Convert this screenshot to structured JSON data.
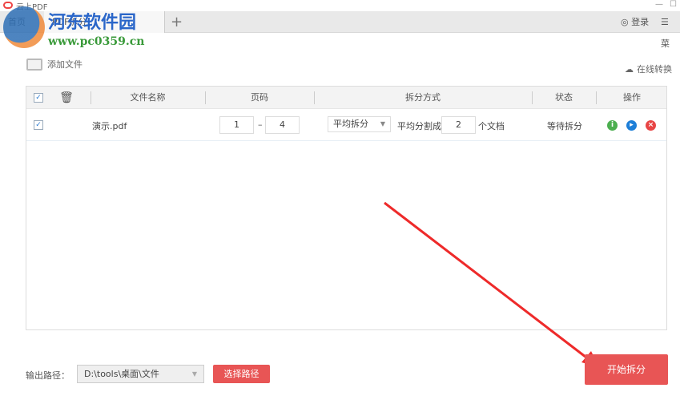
{
  "app": {
    "title": "云上PDF",
    "minimize": "—",
    "maximize": "☐"
  },
  "tabs": [
    {
      "label": "首页"
    },
    {
      "label": "PDF拆分"
    }
  ],
  "add_tab": "+",
  "topbar": {
    "login": "登录",
    "menu": "菜"
  },
  "watermark": {
    "name": "河东软件园",
    "url": "www.pc0359.cn"
  },
  "toolbar": {
    "add_file": "添加文件",
    "online_convert": "在线转换"
  },
  "table": {
    "headers": {
      "name": "文件名称",
      "pages": "页码",
      "split_mode": "拆分方式",
      "status": "状态",
      "actions": "操作"
    },
    "rows": [
      {
        "checked": true,
        "name": "演示.pdf",
        "page_from": "1",
        "dash": "–",
        "page_to": "4",
        "mode": "平均拆分",
        "mode_label": "平均分割成",
        "count": "2",
        "count_suffix": "个文档",
        "status": "等待拆分"
      }
    ]
  },
  "footer": {
    "output_label": "输出路径：",
    "output_path": "D:\\tools\\桌面\\文件",
    "choose_path": "选择路径",
    "start": "开始拆分"
  },
  "colors": {
    "accent": "#e85555",
    "info": "#4caf50",
    "play": "#1e7fd8",
    "delete": "#e84545"
  }
}
